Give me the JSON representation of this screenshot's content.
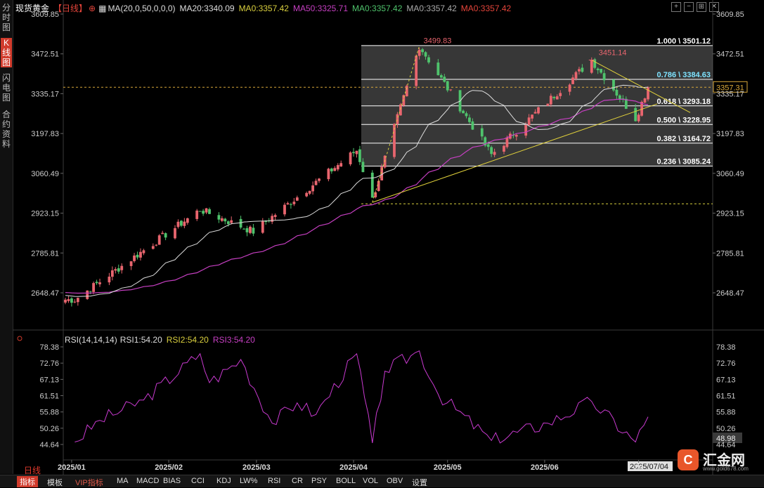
{
  "sidebar": {
    "tabs": [
      "分时图",
      "K线图",
      "闪电图",
      "合约资料"
    ],
    "active": 1
  },
  "header": {
    "symbol": "现货黄金",
    "period_tag": "【日线】",
    "ma_params": "MA(20,0,50,0,0,0)",
    "ma20": "MA20:3340.09",
    "ma0a": "MA0:3357.42",
    "ma50": "MA50:3325.71",
    "ma0b": "MA0:3357.42",
    "ma0c": "MA0:3357.42",
    "ma0d": "MA0:3357.42"
  },
  "colors": {
    "up": "#e8656e",
    "down": "#4fc36c",
    "ma20": "#dddddd",
    "ma50": "#c63fc2",
    "fib": "#ffffff",
    "trend": "#e2d23b",
    "rsi": "#c93ad0",
    "grid": "#333333",
    "accent": "#d13b2c"
  },
  "price_axis": {
    "ticks": [
      "3609.85",
      "3472.51",
      "3335.17",
      "3197.83",
      "3060.49",
      "2923.15",
      "2785.81",
      "2648.47"
    ],
    "current_price": "3357.31"
  },
  "annotations": {
    "high_label": "3499.83",
    "high2_label": "3451.14"
  },
  "fibonacci": [
    {
      "label": "1.000 \\ 3501.12",
      "price": 3501.12
    },
    {
      "label": "0.786 \\ 3384.63",
      "price": 3384.63
    },
    {
      "label": "0.618 \\ 3293.18",
      "price": 3293.18
    },
    {
      "label": "0.500 \\ 3228.95",
      "price": 3228.95
    },
    {
      "label": "0.382 \\ 3164.72",
      "price": 3164.72
    },
    {
      "label": "0.236 \\ 3085.24",
      "price": 3085.24
    }
  ],
  "rsi_panel": {
    "title": "RSI(14,14,14)",
    "rsi1": "RSI1:54.20",
    "rsi2": "RSI2:54.20",
    "rsi3": "RSI3:54.20",
    "ticks": [
      "78.38",
      "72.76",
      "67.13",
      "61.51",
      "55.88",
      "50.26",
      "44.64"
    ],
    "right_value": "48.98"
  },
  "date_axis": {
    "labels": [
      "2025/01",
      "2025/02",
      "2025/03",
      "2025/04",
      "2025/05",
      "2025/06",
      "20"
    ],
    "cursor_date": "2025/07/04"
  },
  "period_label": "日线",
  "bottom_tabs": [
    "指标",
    "模板",
    "VIP指标",
    "MA",
    "MACD",
    "BIAS",
    "CCI",
    "KDJ",
    "LW%",
    "RSI",
    "CR",
    "PSY",
    "BOLL",
    "VOL",
    "OBV",
    "设置"
  ],
  "logo": {
    "text": "汇金网",
    "url": "www.gold678.com"
  },
  "chart_data": {
    "type": "candlestick",
    "title": "现货黄金",
    "period": "日线",
    "x_range": [
      "2024-12-30",
      "2025-07-04"
    ],
    "ylim": [
      2600,
      3630
    ],
    "price_reference": {
      "current": 3357.31
    },
    "swing_points": [
      {
        "date": "2025-01-02",
        "price": 2625
      },
      {
        "date": "2025-02-11",
        "price": 2935
      },
      {
        "date": "2025-02-28",
        "price": 2860
      },
      {
        "date": "2025-04-02",
        "price": 3140
      },
      {
        "date": "2025-04-07",
        "price": 2970
      },
      {
        "date": "2025-04-22",
        "price": 3499.83
      },
      {
        "date": "2025-05-15",
        "price": 3125
      },
      {
        "date": "2025-06-16",
        "price": 3451.14
      },
      {
        "date": "2025-06-30",
        "price": 3250
      },
      {
        "date": "2025-07-04",
        "price": 3357.31
      }
    ],
    "series": [
      {
        "name": "MA20",
        "last": 3340.09
      },
      {
        "name": "MA50",
        "last": 3325.71
      },
      {
        "name": "RSI1",
        "last": 54.2
      },
      {
        "name": "RSI2",
        "last": 54.2
      },
      {
        "name": "RSI3",
        "last": 54.2
      }
    ],
    "rsi": [
      {
        "date": "2025-01-02",
        "value": 45.5
      },
      {
        "date": "2025-01-10",
        "value": 53.0
      },
      {
        "date": "2025-01-24",
        "value": 60.0
      },
      {
        "date": "2025-02-11",
        "value": 76.0
      },
      {
        "date": "2025-02-14",
        "value": 66.0
      },
      {
        "date": "2025-02-24",
        "value": 74.0
      },
      {
        "date": "2025-03-06",
        "value": 52.0
      },
      {
        "date": "2025-03-14",
        "value": 59.0
      },
      {
        "date": "2025-03-20",
        "value": 55.0
      },
      {
        "date": "2025-04-02",
        "value": 76.0
      },
      {
        "date": "2025-04-07",
        "value": 45.0
      },
      {
        "date": "2025-04-11",
        "value": 70.0
      },
      {
        "date": "2025-04-22",
        "value": 77.0
      },
      {
        "date": "2025-04-28",
        "value": 62.0
      },
      {
        "date": "2025-05-15",
        "value": 46.0
      },
      {
        "date": "2025-06-02",
        "value": 52.0
      },
      {
        "date": "2025-06-16",
        "value": 59.5
      },
      {
        "date": "2025-06-30",
        "value": 45.5
      },
      {
        "date": "2025-07-04",
        "value": 54.2
      }
    ]
  }
}
